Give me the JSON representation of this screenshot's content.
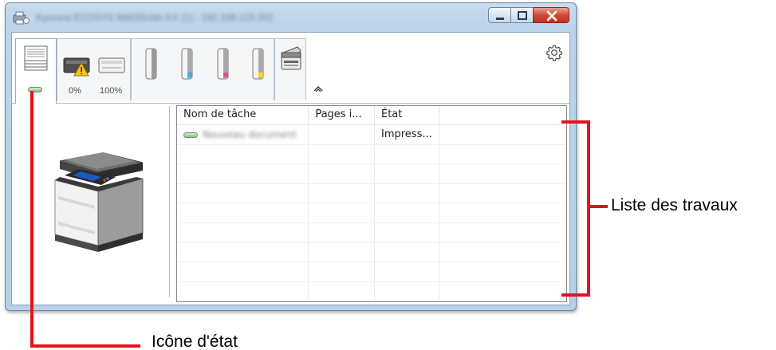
{
  "window": {
    "title": "Kyocera ECOSYS M6635cidn KX (1) - 192.168.123.202"
  },
  "toolbar": {
    "toner_low_percent": "0%",
    "toner_full_percent": "100%",
    "icons": [
      "document-stack-icon",
      "status-indicator-icon",
      "toner-low-warning-icon",
      "toner-full-icon",
      "toner-cartridge-icon",
      "scanner-icon",
      "gear-icon",
      "collapse-arrow-icon"
    ]
  },
  "job_list": {
    "columns": [
      "Nom de tâche",
      "Pages i...",
      "État"
    ],
    "rows": [
      {
        "name": "Nouveau document",
        "pages": "",
        "status": "Impress..."
      }
    ],
    "empty_rows": 8
  },
  "annotations": {
    "job_list_label": "Liste des travaux",
    "status_icon_label": "Icône d'état"
  },
  "colors": {
    "annotation_red": "#e3141b",
    "window_frame": "#bcd3ea",
    "close_button": "#cf4a36"
  }
}
